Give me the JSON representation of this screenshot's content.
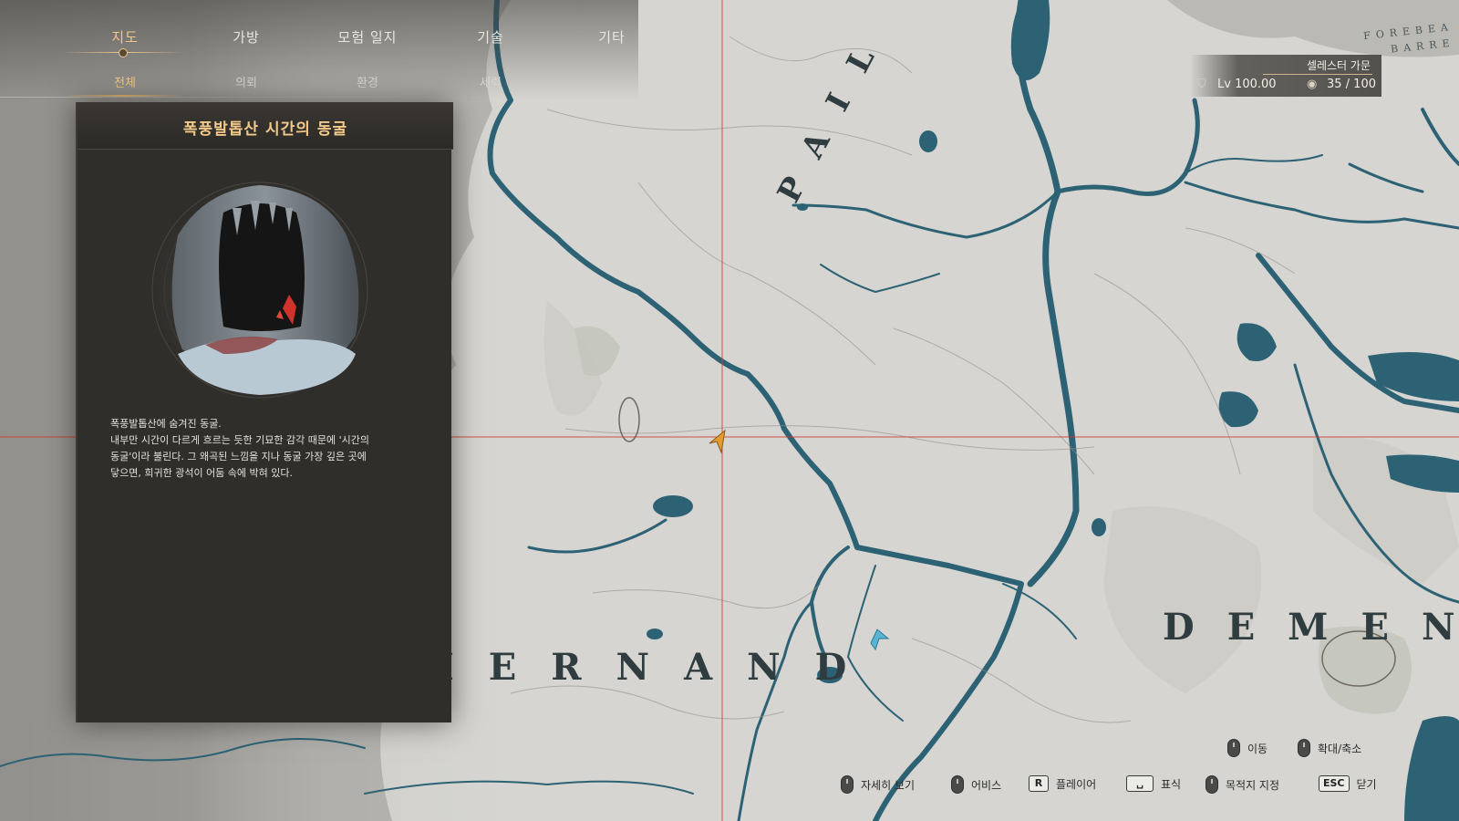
{
  "nav": {
    "tabs": [
      {
        "label": "지도",
        "active": true
      },
      {
        "label": "가방",
        "active": false
      },
      {
        "label": "모험 일지",
        "active": false
      },
      {
        "label": "기술",
        "active": false
      },
      {
        "label": "기타",
        "active": false
      }
    ],
    "subtabs": [
      {
        "label": "전체",
        "active": true
      },
      {
        "label": "의뢰",
        "active": false
      },
      {
        "label": "환경",
        "active": false
      },
      {
        "label": "세력",
        "active": false
      }
    ]
  },
  "panel": {
    "title": "폭풍발톱산 시간의 동굴",
    "description": [
      "폭풍발톱산에 숨겨진 동굴.",
      "내부만 시간이 다르게 흐르는 듯한 기묘한 감각 때문에 '시간의",
      "동굴'이라 불린다. 그 왜곡된 느낌을 지나 동굴 가장 깊은 곳에",
      "닿으면, 희귀한 광석이 어둠 속에 박혀 있다."
    ]
  },
  "player": {
    "faction": "셀레스터 가문",
    "level": "Lv 100.00",
    "count": "35 / 100"
  },
  "map": {
    "regions": {
      "hernand": "HERNAND",
      "demen": "DEMEN",
      "pailune": "PAIL",
      "forebeam": "FOREBEA",
      "barrens": "BARRE"
    },
    "colors": {
      "land": "#d6d5d1",
      "water": "#2d6275",
      "crosshair": "#d23a2a",
      "player_marker": "#e59a32",
      "waypoint": "#59b5d3"
    }
  },
  "controls": [
    {
      "key_type": "mouse",
      "key": "",
      "label": "이동"
    },
    {
      "key_type": "mouse",
      "key": "",
      "label": "확대/축소"
    },
    {
      "key_type": "mouse",
      "key": "",
      "label": "자세히 보기"
    },
    {
      "key_type": "mouse",
      "key": "",
      "label": "어비스"
    },
    {
      "key_type": "key",
      "key": "R",
      "label": "플레이어"
    },
    {
      "key_type": "key",
      "key": "␣",
      "label": "표식"
    },
    {
      "key_type": "mouse",
      "key": "",
      "label": "목적지 지정"
    },
    {
      "key_type": "key",
      "key": "ESC",
      "label": "닫기"
    }
  ]
}
